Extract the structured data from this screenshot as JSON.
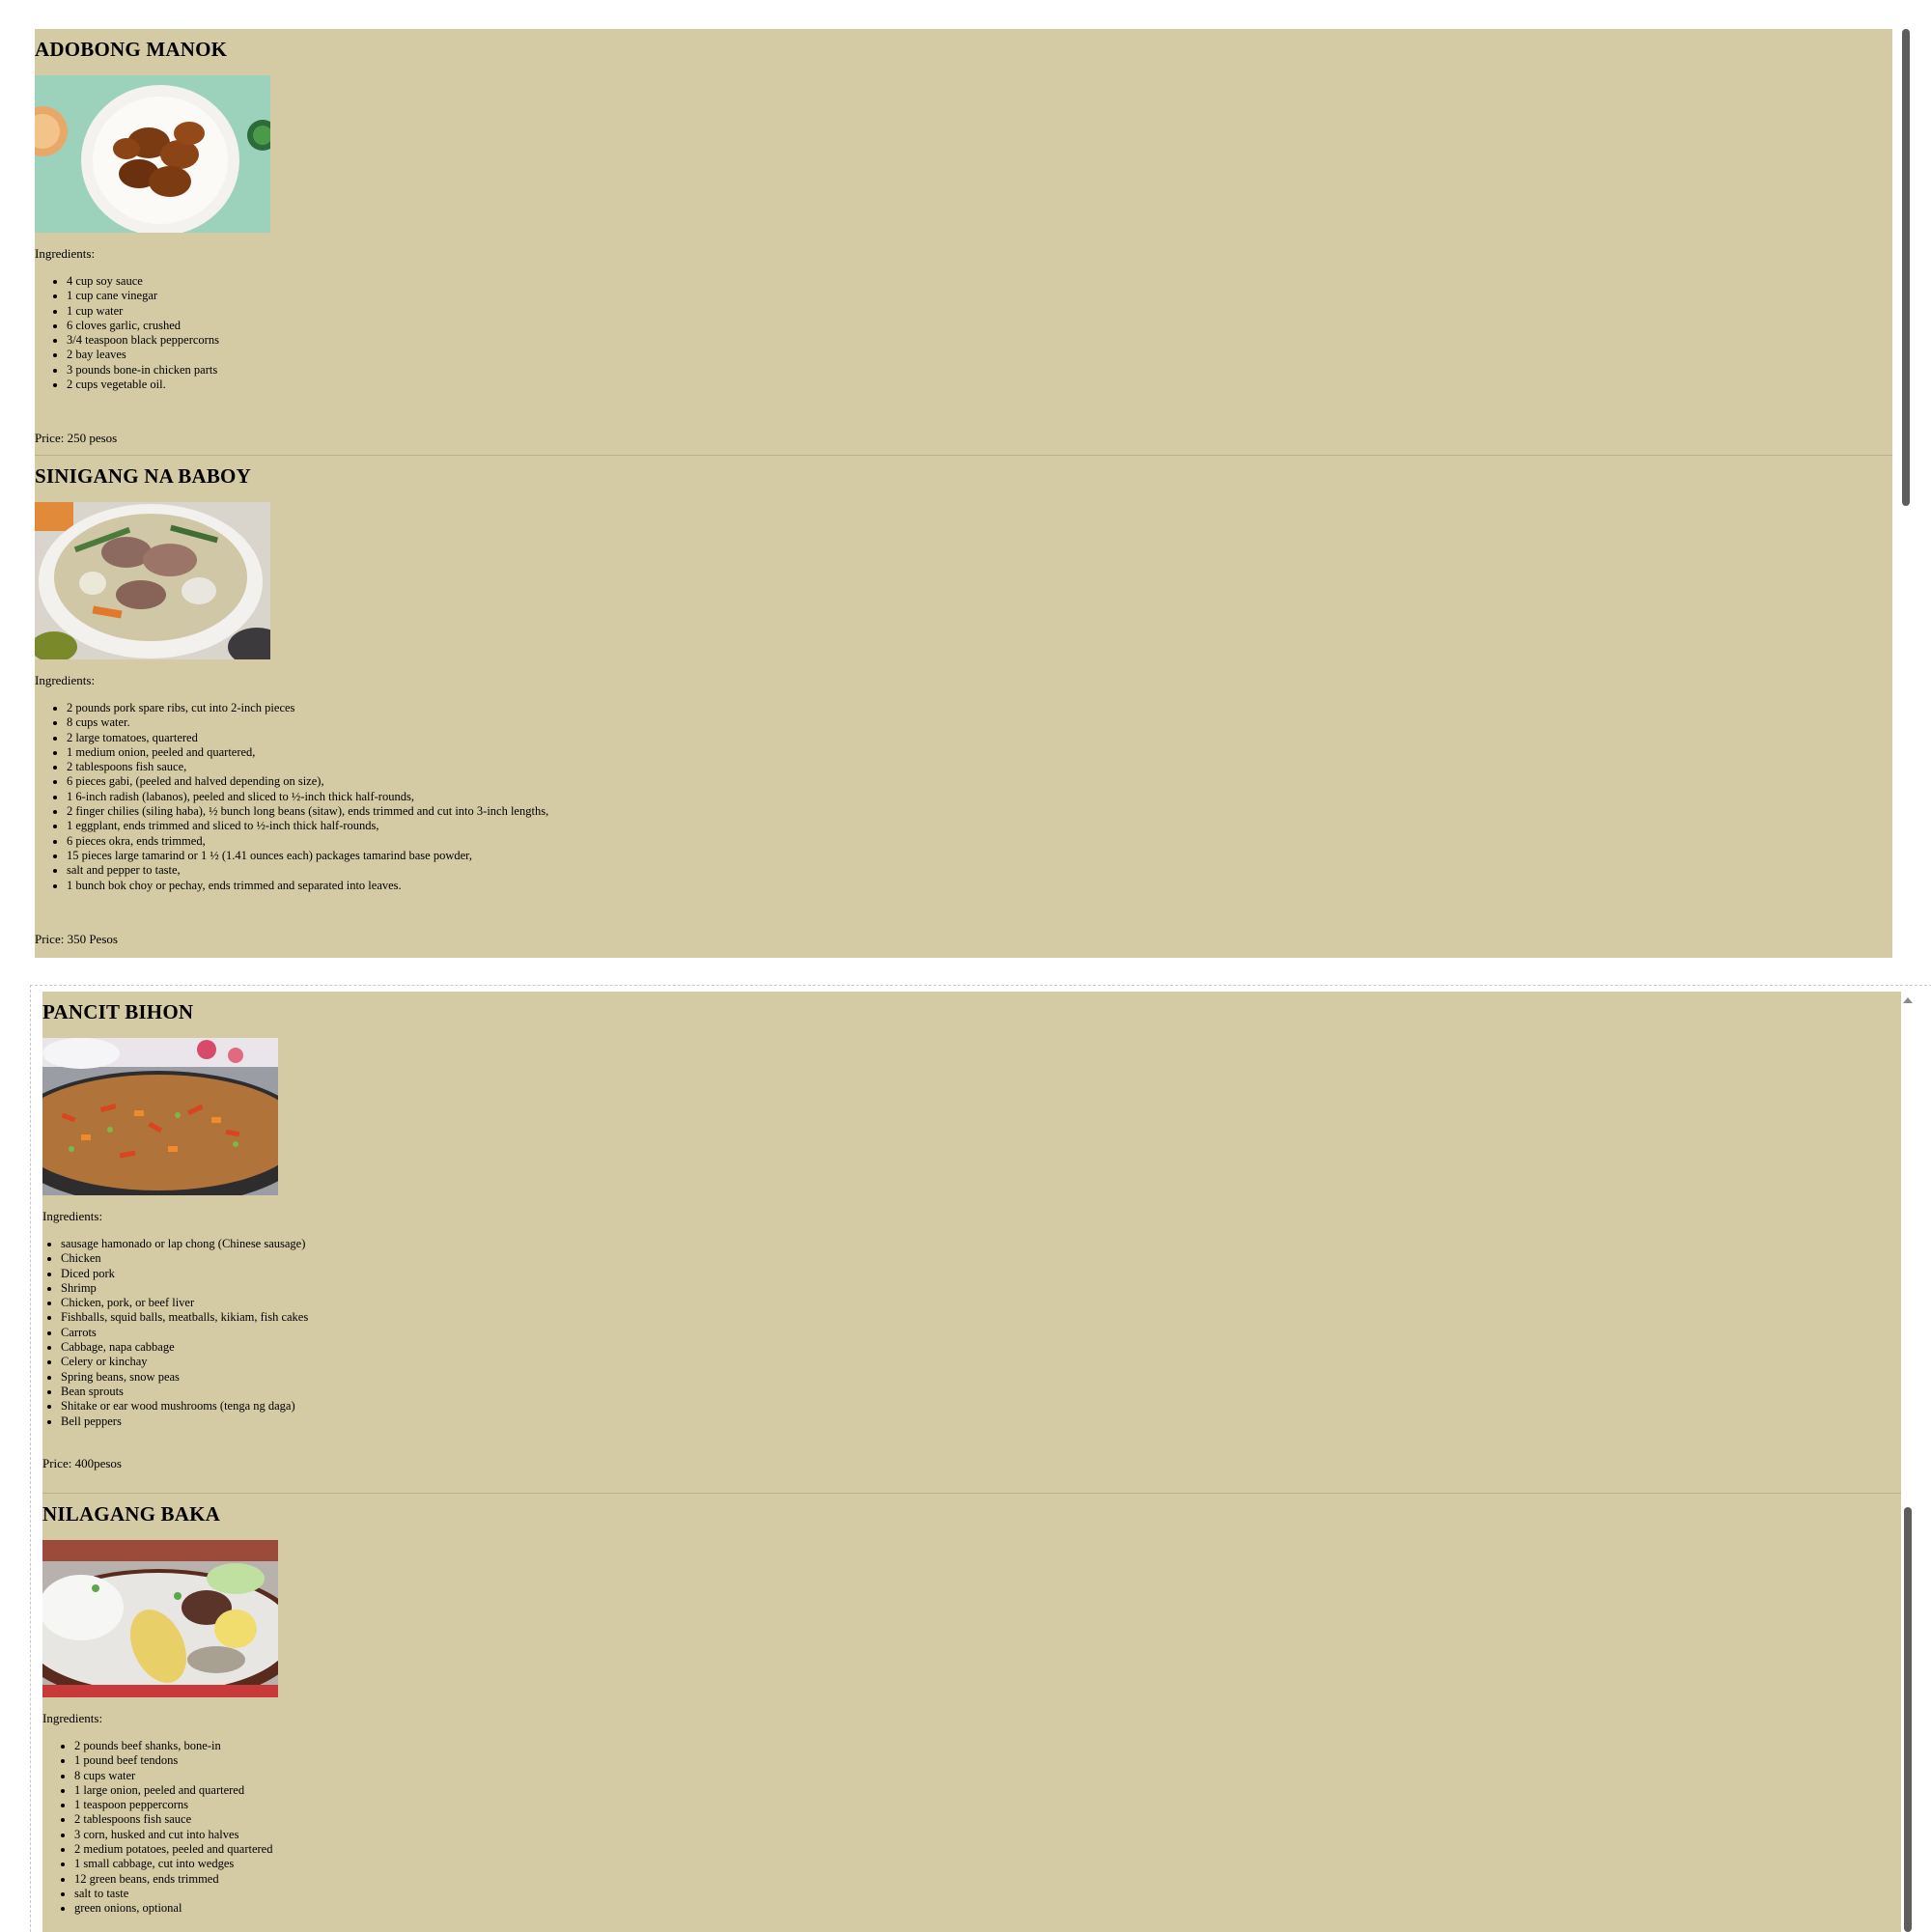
{
  "recipes_top": [
    {
      "title": "ADOBONG MANOK",
      "ingredients_label": "Ingredients:",
      "ingredients": [
        "4 cup soy sauce",
        "1 cup cane vinegar",
        "1 cup water",
        "6 cloves garlic, crushed",
        "3/4 teaspoon black peppercorns",
        "2 bay leaves",
        "3 pounds bone-in chicken parts",
        "2 cups vegetable oil."
      ],
      "price": "Price: 250 pesos"
    },
    {
      "title": "SINIGANG NA BABOY",
      "ingredients_label": "Ingredients:",
      "ingredients": [
        "2 pounds pork spare ribs, cut into 2-inch pieces",
        "8 cups water.",
        "2 large tomatoes, quartered",
        "1 medium onion, peeled and quartered,",
        "2 tablespoons fish sauce,",
        "6 pieces gabi, (peeled and halved depending on size),",
        "1 6-inch radish (labanos), peeled and sliced to ½-inch thick half-rounds,",
        "2 finger chilies (siling haba), ½ bunch long beans (sitaw), ends trimmed and cut into 3-inch lengths,",
        "1 eggplant, ends trimmed and sliced to ½-inch thick half-rounds,",
        "6 pieces okra, ends trimmed,",
        "15 pieces large tamarind or 1 ½ (1.41 ounces each) packages tamarind base powder,",
        "salt and pepper to taste,",
        "1 bunch bok choy or pechay, ends trimmed and separated into leaves."
      ],
      "price": "Price: 350 Pesos"
    }
  ],
  "recipes_bottom": [
    {
      "title": "PANCIT BIHON",
      "ingredients_label": "Ingredients:",
      "ingredients": [
        "sausage hamonado or lap chong (Chinese sausage)",
        "Chicken",
        "Diced pork",
        "Shrimp",
        "Chicken, pork, or beef liver",
        "Fishballs, squid balls, meatballs, kikiam, fish cakes",
        "Carrots",
        "Cabbage, napa cabbage",
        "Celery or kinchay",
        "Spring beans, snow peas",
        "Bean sprouts",
        "Shitake or ear wood mushrooms (tenga ng daga)",
        "Bell peppers"
      ],
      "price": "Price: 400pesos"
    },
    {
      "title": "NILAGANG BAKA",
      "ingredients_label": "Ingredients:",
      "ingredients": [
        "2 pounds beef shanks, bone-in",
        "1 pound beef tendons",
        "8 cups water",
        "1 large onion, peeled and quartered",
        "1 teaspoon peppercorns",
        "2 tablespoons fish sauce",
        "3 corn, husked and cut into halves",
        "2 medium potatoes, peeled and quartered",
        "1 small cabbage, cut into wedges",
        "12 green beans, ends trimmed",
        "salt to taste",
        "green onions, optional"
      ],
      "price": ""
    }
  ],
  "photos": {
    "adobo": "chicken-adobo-photo",
    "sinigang": "pork-sinigang-photo",
    "pancit": "pancit-bihon-photo",
    "nilaga": "beef-nilaga-photo"
  },
  "colors": {
    "panel_background": "#d4caa4",
    "scrollbar_thumb": "#5d5d5d"
  }
}
